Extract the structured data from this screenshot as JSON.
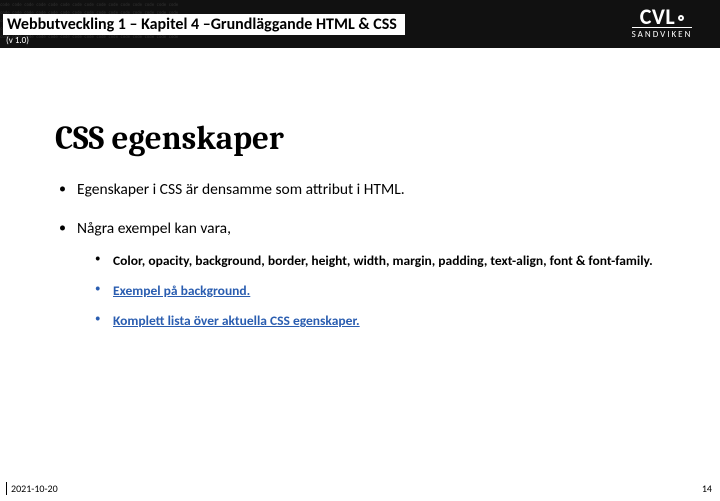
{
  "header": {
    "title": "Webbutveckling 1  – Kapitel 4 –Grundläggande HTML & CSS",
    "version": "(v 1.0)",
    "logo_top": "CVL",
    "logo_bottom": "SANDVIKEN"
  },
  "content": {
    "heading": "CSS egenskaper",
    "bullets": [
      {
        "text": "Egenskaper i CSS är densamme som attribut i HTML."
      },
      {
        "text": "Några exempel kan vara,",
        "sub": [
          {
            "text": "Color, opacity, background, border, height, width, margin, padding, text-align, font & font-family.",
            "link": false
          },
          {
            "text": "Exempel på background.",
            "link": true
          },
          {
            "text": "Komplett lista över aktuella CSS egenskaper.",
            "link": true
          }
        ]
      }
    ]
  },
  "footer": {
    "date": "2021-10-20",
    "page": "14"
  }
}
